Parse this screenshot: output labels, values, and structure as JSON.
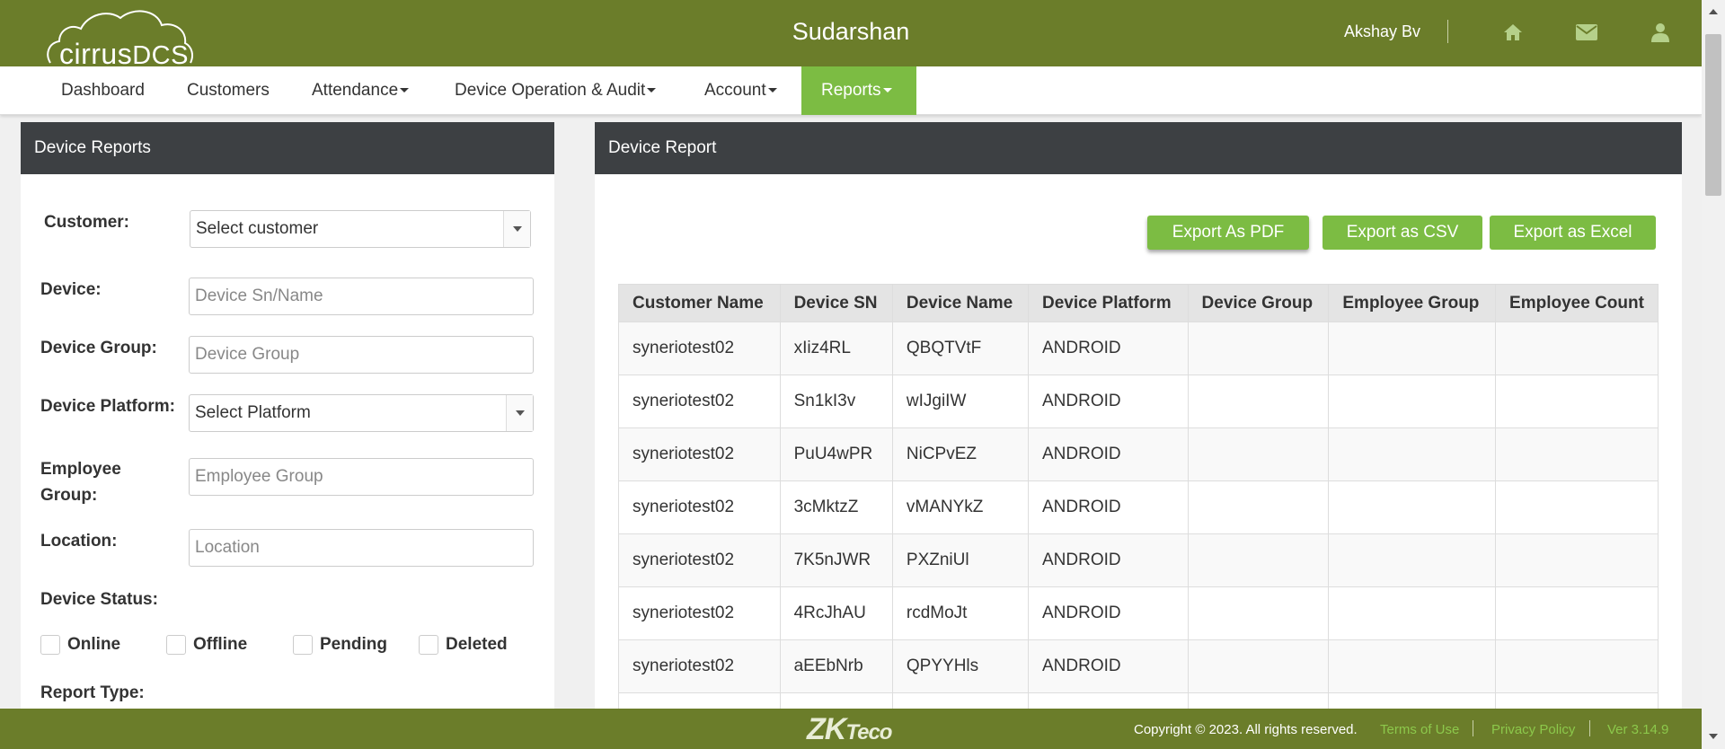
{
  "header": {
    "logo_text_left": "cirrus",
    "logo_text_right": "DCS",
    "title": "Sudarshan",
    "user_name": "Akshay Bv",
    "icons": [
      "home-icon",
      "envelope-icon",
      "user-icon"
    ]
  },
  "nav": {
    "items": [
      {
        "label": "Dashboard"
      },
      {
        "label": "Customers"
      },
      {
        "label": "Attendance"
      },
      {
        "label": "Device Operation & Audit"
      },
      {
        "label": "Account"
      },
      {
        "label": "Reports"
      }
    ],
    "active": "Reports"
  },
  "left_panel": {
    "title": "Device Reports",
    "customer_label": "Customer:",
    "customer_value": "Select customer",
    "device_label": "Device:",
    "device_placeholder": "Device Sn/Name",
    "device_group_label": "Device Group:",
    "device_group_placeholder": "Device Group",
    "platform_label": "Device Platform:",
    "platform_value": "Select Platform",
    "employee_group_label_1": "Employee",
    "employee_group_label_2": "Group:",
    "employee_group_placeholder": "Employee Group",
    "location_label": "Location:",
    "location_placeholder": "Location",
    "status_label": "Device Status:",
    "status_options": [
      "Online",
      "Offline",
      "Pending",
      "Deleted"
    ],
    "report_type_label": "Report Type:"
  },
  "right_panel": {
    "title": "Device Report",
    "buttons": {
      "pdf": "Export As PDF",
      "csv": "Export as CSV",
      "excel": "Export as Excel"
    },
    "columns": [
      "Customer Name",
      "Device SN",
      "Device Name",
      "Device Platform",
      "Device Group",
      "Employee Group",
      "Employee Count"
    ],
    "rows": [
      [
        "syneriotest02",
        "xIiz4RL",
        "QBQTVtF",
        "ANDROID",
        "",
        "",
        ""
      ],
      [
        "syneriotest02",
        "Sn1kI3v",
        "wIJgiIW",
        "ANDROID",
        "",
        "",
        ""
      ],
      [
        "syneriotest02",
        "PuU4wPR",
        "NiCPvEZ",
        "ANDROID",
        "",
        "",
        ""
      ],
      [
        "syneriotest02",
        "3cMktzZ",
        "vMANYkZ",
        "ANDROID",
        "",
        "",
        ""
      ],
      [
        "syneriotest02",
        "7K5nJWR",
        "PXZniUl",
        "ANDROID",
        "",
        "",
        ""
      ],
      [
        "syneriotest02",
        "4RcJhAU",
        "rcdMoJt",
        "ANDROID",
        "",
        "",
        ""
      ],
      [
        "syneriotest02",
        "aEEbNrb",
        "QPYYHls",
        "ANDROID",
        "",
        "",
        ""
      ],
      [
        "",
        "",
        "",
        "",
        "",
        "",
        ""
      ]
    ]
  },
  "footer": {
    "logo_zk": "ZK",
    "logo_teco": "Teco",
    "copyright": "Copyright © 2023. All rights reserved.",
    "terms": "Terms of Use",
    "privacy": "Privacy Policy",
    "version": "Ver 3.14.9"
  },
  "colors": {
    "header_bg": "#6b7d2a",
    "accent_green": "#7cbc43",
    "panel_head_bg": "#3d4043"
  }
}
